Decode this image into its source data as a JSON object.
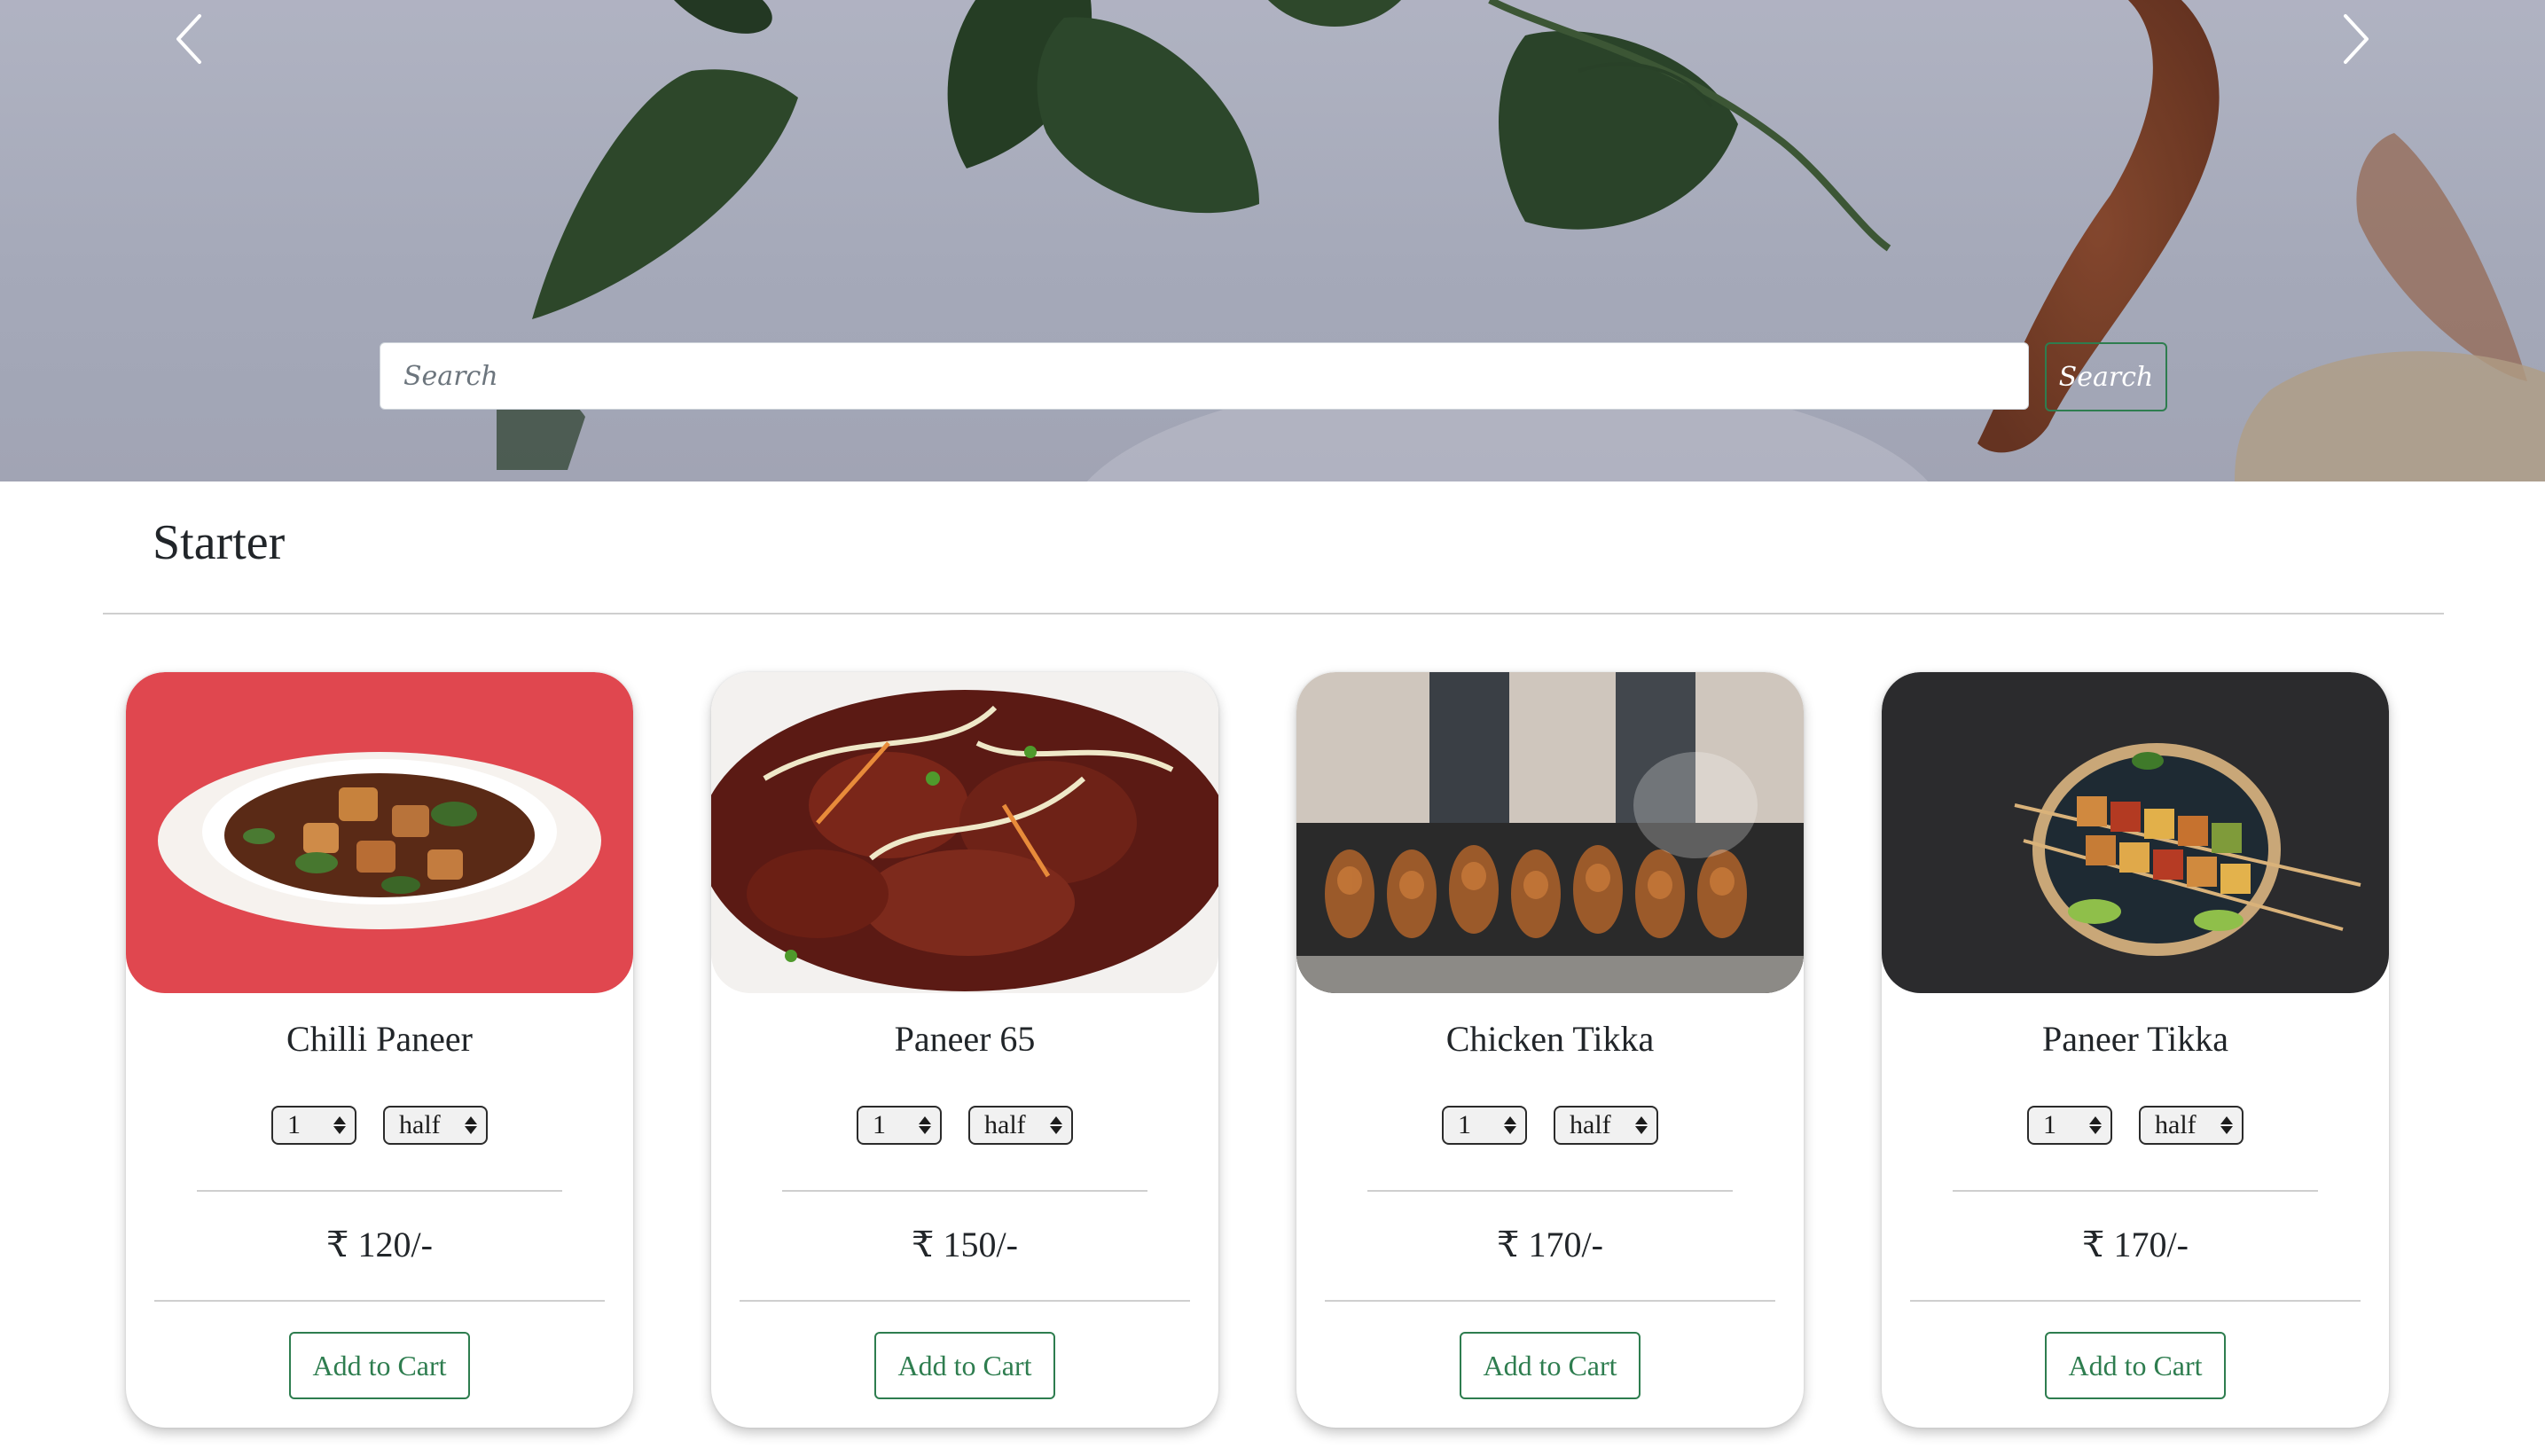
{
  "hero": {
    "search": {
      "placeholder": "Search",
      "button_label": "Search"
    },
    "prev_icon": "chevron-left-icon",
    "next_icon": "chevron-right-icon"
  },
  "section": {
    "title": "Starter"
  },
  "cards": [
    {
      "name": "Chilli Paneer",
      "quantity": "1",
      "size": "half",
      "price": "₹ 120/-",
      "button": "Add to Cart"
    },
    {
      "name": "Paneer 65",
      "quantity": "1",
      "size": "half",
      "price": "₹ 150/-",
      "button": "Add to Cart"
    },
    {
      "name": "Chicken Tikka",
      "quantity": "1",
      "size": "half",
      "price": "₹ 170/-",
      "button": "Add to Cart"
    },
    {
      "name": "Paneer Tikka",
      "quantity": "1",
      "size": "half",
      "price": "₹ 170/-",
      "button": "Add to Cart"
    }
  ],
  "colors": {
    "accent_green": "#2e7d4f",
    "divider": "#cfcfcf"
  }
}
